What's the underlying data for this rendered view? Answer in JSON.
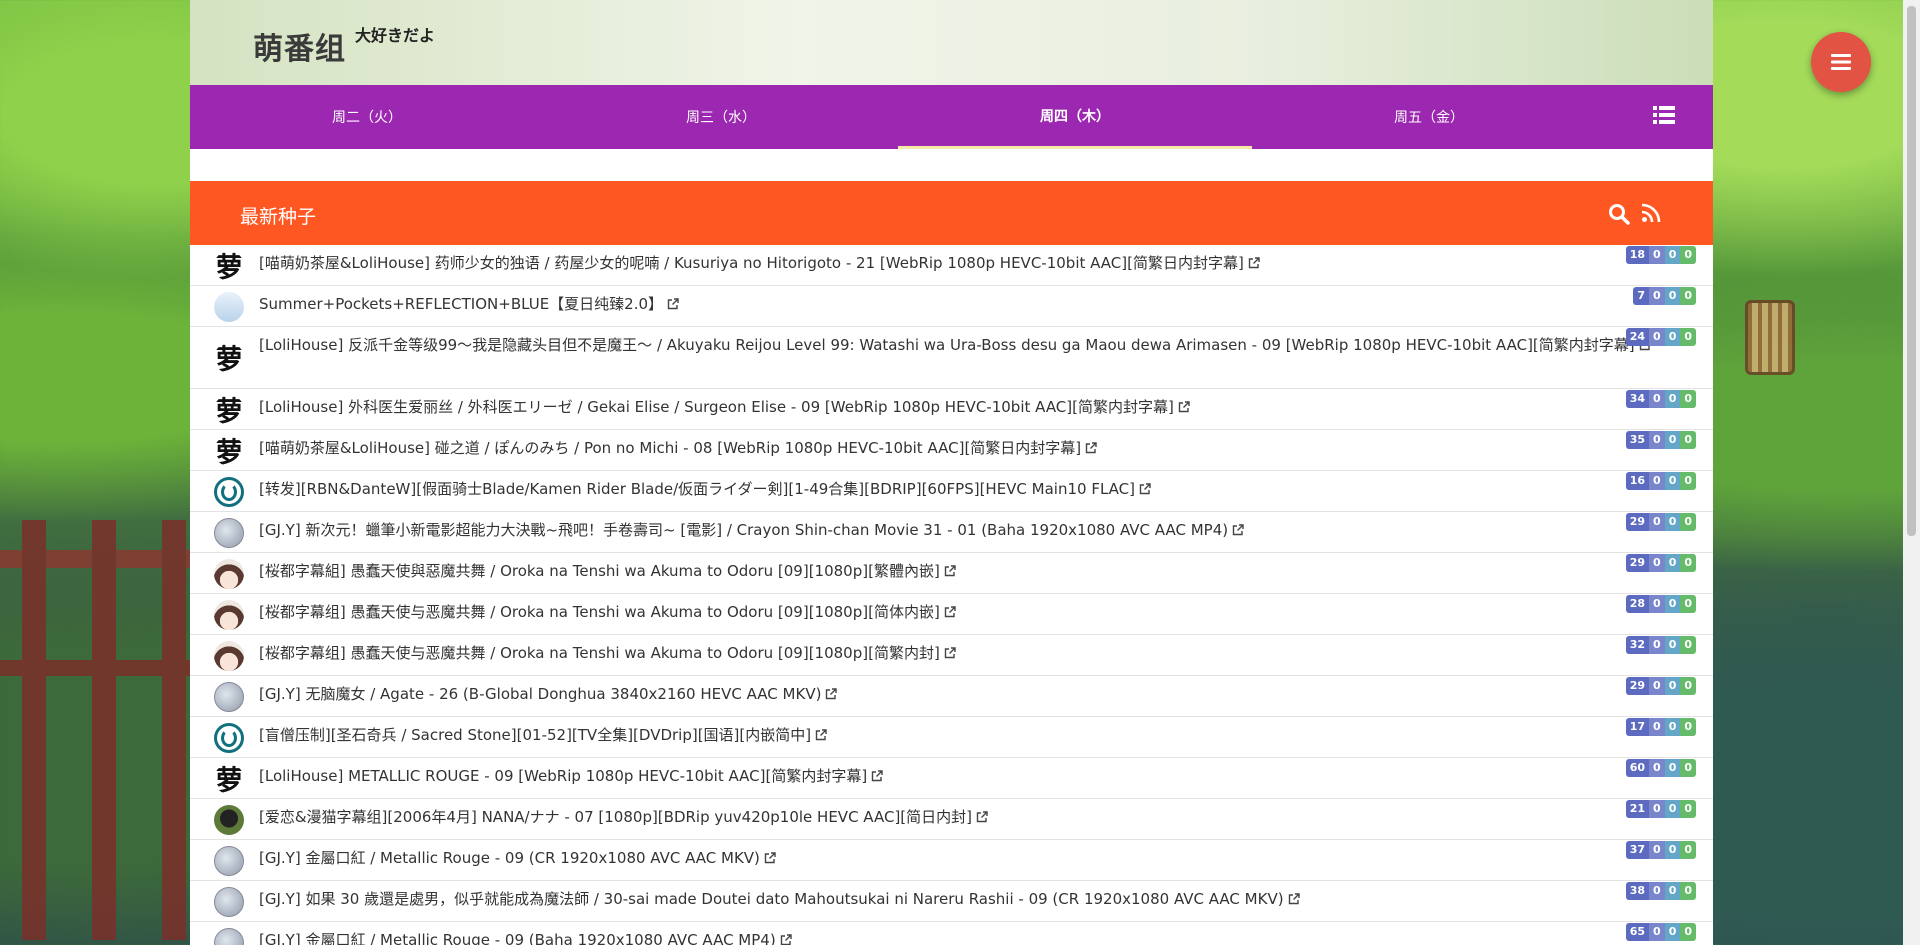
{
  "site": {
    "logo": "萌番组",
    "tagline": "大好きだよ"
  },
  "nav": {
    "tabs": [
      {
        "label": "周二（火）",
        "active": false
      },
      {
        "label": "周三（水）",
        "active": false
      },
      {
        "label": "周四（木）",
        "active": true
      },
      {
        "label": "周五（金）",
        "active": false
      }
    ],
    "list_icon": "list-icon"
  },
  "section": {
    "title": "最新种子",
    "search_icon": "search-icon",
    "rss_icon": "rss-icon"
  },
  "fab": {
    "icon": "menu-icon"
  },
  "colors": {
    "nav": "#9c27b0",
    "section": "#ff5722",
    "fab": "#e25343"
  },
  "torrents": [
    {
      "avatar": "meng",
      "title": "[喵萌奶茶屋&LoliHouse] 药师少女的独语 / 药屋少女的呢喃 / Kusuriya no Hitorigoto - 21 [WebRip 1080p HEVC-10bit AAC][简繁日内封字幕]",
      "seeds": "18",
      "a": "0",
      "b": "0",
      "c": "0"
    },
    {
      "avatar": "pocket",
      "title": "Summer+Pockets+REFLECTION+BLUE【夏日纯臻2.0】",
      "seeds": "7",
      "a": "0",
      "b": "0",
      "c": "0"
    },
    {
      "avatar": "meng",
      "title": "[LoliHouse] 反派千金等级99～我是隐藏头目但不是魔王～ / Akuyaku Reijou Level 99: Watashi wa Ura-Boss desu ga Maou dewa Arimasen - 09 [WebRip 1080p HEVC-10bit AAC][简繁内封字幕]",
      "seeds": "24",
      "a": "0",
      "b": "0",
      "c": "0",
      "tall": true
    },
    {
      "avatar": "meng",
      "title": "[LoliHouse] 外科医生爱丽丝 / 外科医エリーゼ / Gekai Elise / Surgeon Elise - 09 [WebRip 1080p HEVC-10bit AAC][简繁内封字幕]",
      "seeds": "34",
      "a": "0",
      "b": "0",
      "c": "0"
    },
    {
      "avatar": "meng",
      "title": "[喵萌奶茶屋&LoliHouse] 碰之道 / ぽんのみち / Pon no Michi - 08 [WebRip 1080p HEVC-10bit AAC][简繁日内封字幕]",
      "seeds": "35",
      "a": "0",
      "b": "0",
      "c": "0"
    },
    {
      "avatar": "power",
      "title": "[转发][RBN&DanteW][假面骑士Blade/Kamen Rider Blade/仮面ライダー剣][1-49合集][BDRIP][60FPS][HEVC Main10 FLAC]",
      "seeds": "16",
      "a": "0",
      "b": "0",
      "c": "0"
    },
    {
      "avatar": "gjy",
      "title": "[GJ.Y] 新次元！蠟筆小新電影超能力大決戰~飛吧！手卷壽司~ [電影] / Crayon Shin-chan Movie 31 - 01 (Baha 1920x1080 AVC AAC MP4)",
      "seeds": "29",
      "a": "0",
      "b": "0",
      "c": "0"
    },
    {
      "avatar": "girl",
      "title": "[桜都字幕組] 愚蠢天使與惡魔共舞 / Oroka na Tenshi wa Akuma to Odoru [09][1080p][繁體內嵌]",
      "seeds": "29",
      "a": "0",
      "b": "0",
      "c": "0"
    },
    {
      "avatar": "girl",
      "title": "[桜都字幕组] 愚蠢天使与恶魔共舞 / Oroka na Tenshi wa Akuma to Odoru [09][1080p][简体内嵌]",
      "seeds": "28",
      "a": "0",
      "b": "0",
      "c": "0"
    },
    {
      "avatar": "girl",
      "title": "[桜都字幕组] 愚蠢天使与恶魔共舞 / Oroka na Tenshi wa Akuma to Odoru [09][1080p][简繁内封]",
      "seeds": "32",
      "a": "0",
      "b": "0",
      "c": "0"
    },
    {
      "avatar": "gjy",
      "title": "[GJ.Y] 无脑魔女 / Agate - 26 (B-Global Donghua 3840x2160 HEVC AAC MKV)",
      "seeds": "29",
      "a": "0",
      "b": "0",
      "c": "0"
    },
    {
      "avatar": "power",
      "title": "[盲僧压制][圣石奇兵 / Sacred Stone][01-52][TV全集][DVDrip][国语][内嵌简中]",
      "seeds": "17",
      "a": "0",
      "b": "0",
      "c": "0"
    },
    {
      "avatar": "meng",
      "title": "[LoliHouse] METALLIC ROUGE - 09 [WebRip 1080p HEVC-10bit AAC][简繁内封字幕]",
      "seeds": "60",
      "a": "0",
      "b": "0",
      "c": "0"
    },
    {
      "avatar": "nana",
      "title": "[爱恋&漫猫字幕组][2006年4月] NANA/ナナ - 07 [1080p][BDRip yuv420p10le HEVC AAC][简日内封]",
      "seeds": "21",
      "a": "0",
      "b": "0",
      "c": "0"
    },
    {
      "avatar": "gjy",
      "title": "[GJ.Y] 金屬口紅 / Metallic Rouge - 09 (CR 1920x1080 AVC AAC MKV)",
      "seeds": "37",
      "a": "0",
      "b": "0",
      "c": "0"
    },
    {
      "avatar": "gjy",
      "title": "[GJ.Y] 如果 30 歲還是處男，似乎就能成為魔法師 / 30-sai made Doutei dato Mahoutsukai ni Nareru Rashii - 09 (CR 1920x1080 AVC AAC MKV)",
      "seeds": "38",
      "a": "0",
      "b": "0",
      "c": "0"
    },
    {
      "avatar": "gjy",
      "title": "[GJ.Y] 金屬口紅 / Metallic Rouge - 09 (Baha 1920x1080 AVC AAC MP4)",
      "seeds": "65",
      "a": "0",
      "b": "0",
      "c": "0"
    }
  ]
}
